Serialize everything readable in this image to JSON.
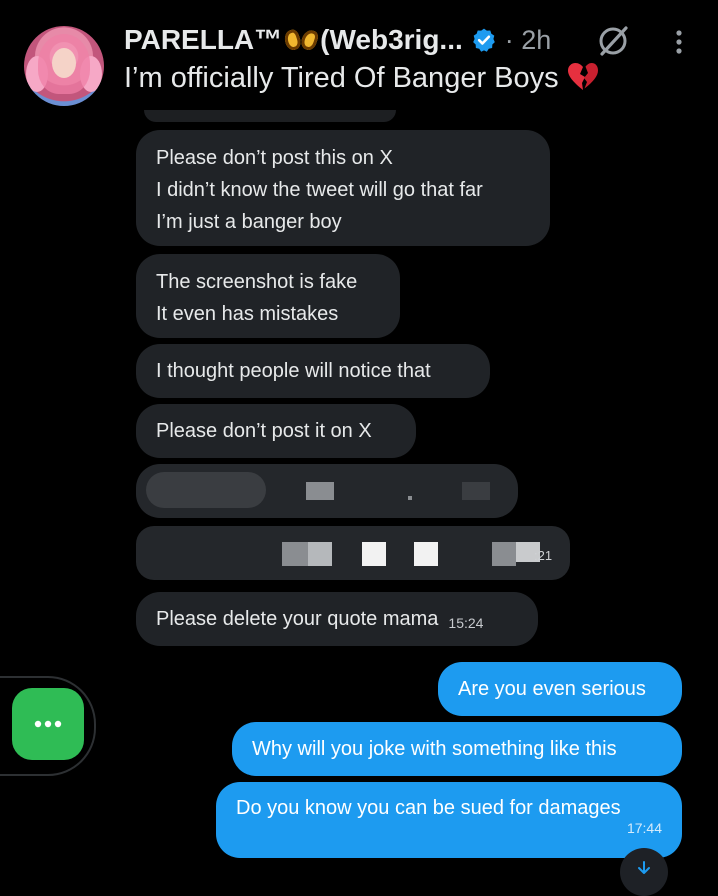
{
  "post": {
    "author_name": "PARELLA™",
    "author_handle": "(Web3rig...",
    "time_ago": "· 2h",
    "text": "I’m officially Tired Of Banger Boys",
    "icons": [
      "avatar",
      "butterfly-icon",
      "verified-icon",
      "grok-icon",
      "more-icon",
      "broken-heart-icon"
    ]
  },
  "messages": [
    {
      "id": "m1",
      "lines": [
        "Please don’t post this on X",
        "I didn’t know the tweet will go that far",
        "I’m just a banger boy"
      ]
    },
    {
      "id": "m2",
      "lines": [
        "The screenshot is fake",
        "It even has mistakes"
      ]
    },
    {
      "id": "m3",
      "lines": [
        "I thought people will notice that"
      ]
    },
    {
      "id": "m4",
      "lines": [
        "Please don’t post it on X"
      ]
    },
    {
      "id": "m5",
      "text": "Please delete your quote mama",
      "time": "15:24"
    },
    {
      "id": "m6",
      "text": "Are you even serious"
    },
    {
      "id": "m7",
      "text": "Why will you joke with something like this"
    },
    {
      "id": "m8",
      "text": "Do you know you can be sued for damages",
      "time": "17:44"
    }
  ],
  "redacted_fragment": ":21",
  "colors": {
    "incoming": "#202327",
    "outgoing": "#1d9bf0",
    "fab": "#2fbc55",
    "background": "#000000"
  }
}
